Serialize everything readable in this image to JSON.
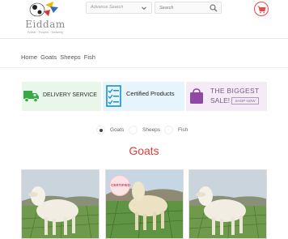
{
  "header": {
    "logo_text": "Eiddam",
    "logo_tagline": "Fresh · Frozen · Delivery",
    "advanced_search_label": "Advance Search",
    "search_placeholder": "Search"
  },
  "breadcrumb": [
    "Home",
    "Goats",
    "Sheeps",
    "Fish"
  ],
  "banners": {
    "delivery": "DELIVERY SERVICE",
    "certified": "Certified Products",
    "sale_line1": "THE BIGGEST",
    "sale_line2": "SALE!",
    "sale_button": "SHOP NOW"
  },
  "filters": {
    "options": [
      "Goats",
      "Sheeps",
      "Fish"
    ],
    "selected": "Goats"
  },
  "section_title": "Goats",
  "cards": [
    {
      "badge": ""
    },
    {
      "badge": "CERTIFIED"
    },
    {
      "badge": ""
    }
  ],
  "colors": {
    "accent_red": "#e0403b",
    "delivery_green": "#3aa845",
    "certified_blue": "#1b8fc7",
    "sale_purple": "#8e4aa3"
  }
}
